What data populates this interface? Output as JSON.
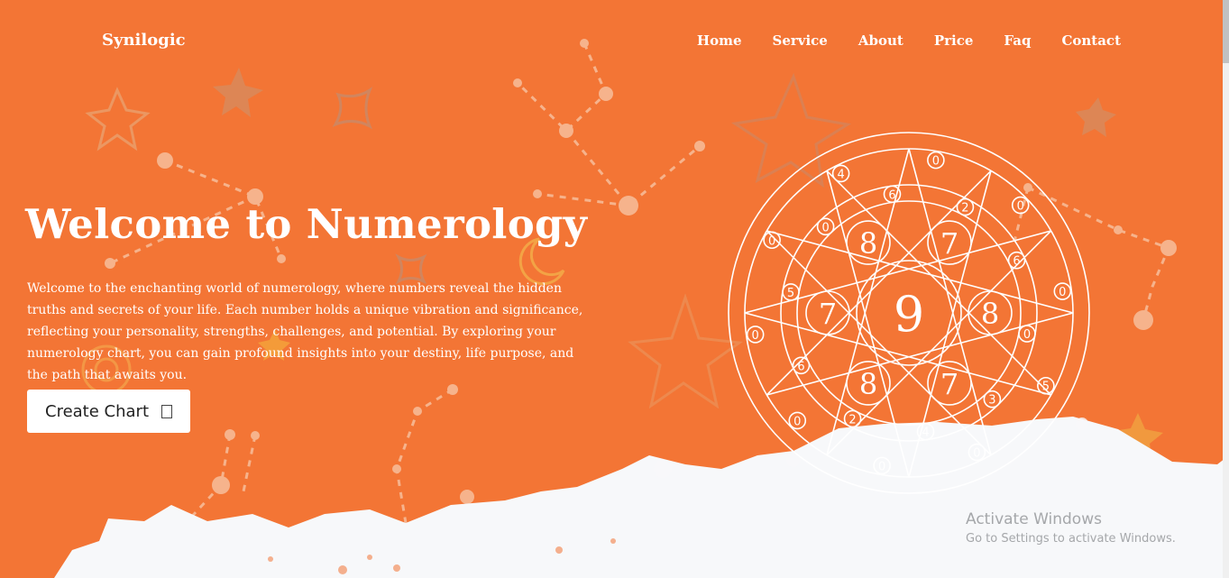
{
  "brand": "Synilogic",
  "nav": {
    "items": [
      {
        "label": "Home"
      },
      {
        "label": "Service"
      },
      {
        "label": "About"
      },
      {
        "label": "Price"
      },
      {
        "label": "Faq"
      },
      {
        "label": "Contact"
      }
    ]
  },
  "hero": {
    "title": "Welcome to Numerology",
    "description": "Welcome to the enchanting world of numerology, where numbers reveal the hidden truths and secrets of your life. Each number holds a unique vibration and significance, reflecting your personality, strengths, challenges, and potential. By exploring your numerology chart, you can gain profound insights into your destiny, life purpose, and the path that awaits you.",
    "cta_label": "Create Chart",
    "cta_icon": "square-glyph-icon"
  },
  "wheel": {
    "center": "9",
    "inner": [
      "8",
      "7",
      "8",
      "7",
      "8",
      "7"
    ],
    "small": [
      "0",
      "2",
      "0",
      "6",
      "0",
      "0",
      "5",
      "3",
      "0",
      "4",
      "0",
      "2",
      "0",
      "6",
      "0",
      "5",
      "0",
      "0",
      "4",
      "6"
    ]
  },
  "watermark": {
    "title": "Activate Windows",
    "subtitle": "Go to Settings to activate Windows."
  },
  "colors": {
    "background": "#f37535",
    "paint": "#f7f8fa",
    "accent_decor": "#e9a06f"
  }
}
